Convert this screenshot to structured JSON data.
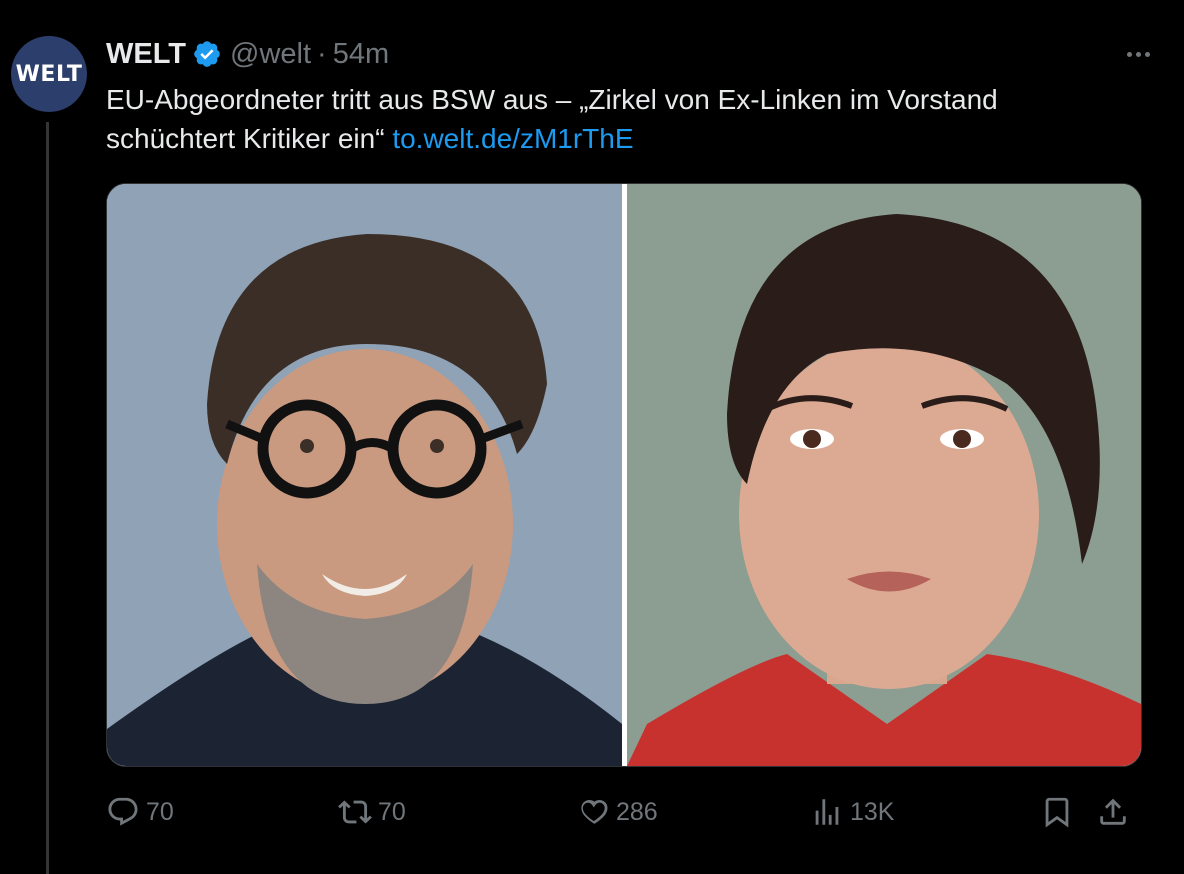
{
  "tweet": {
    "author_name": "WELT",
    "handle": "@welt",
    "separator": "·",
    "time": "54m",
    "avatar_text": "WELT",
    "text": "EU-Abgeordneter tritt aus BSW aus – „Zirkel von Ex-Linken im Vorstand schüchtert Kritiker ein“",
    "link": "to.welt.de/zM1rThE"
  },
  "actions": {
    "replies": "70",
    "reposts": "70",
    "likes": "286",
    "views": "13K"
  },
  "colors": {
    "background": "#000000",
    "text": "#e7e9ea",
    "muted": "#71767b",
    "link": "#1d9bf0",
    "verified": "#1d9bf0"
  },
  "icons": [
    "verified-badge-icon",
    "more-options-icon",
    "reply-icon",
    "repost-icon",
    "like-icon",
    "views-icon",
    "bookmark-icon",
    "share-icon"
  ]
}
